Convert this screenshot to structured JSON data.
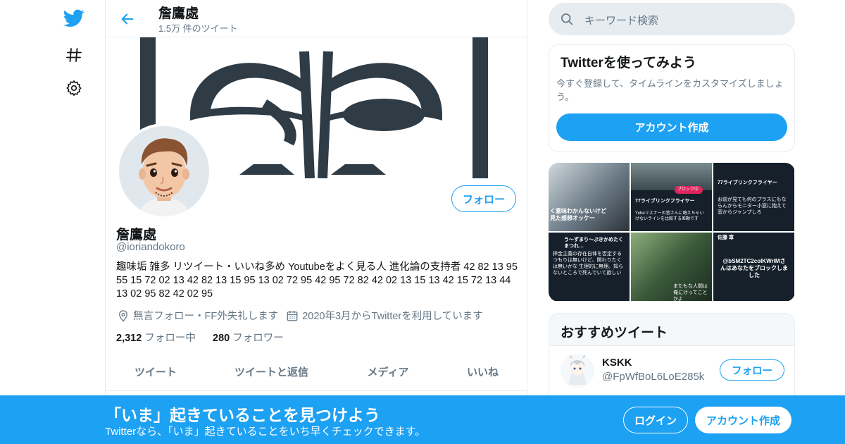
{
  "colors": {
    "accent": "#1da1f2",
    "text": "#14171a",
    "muted": "#657786",
    "border": "#e6ecf0"
  },
  "nav": {
    "icons": [
      "twitter-logo-icon",
      "hashtag-icon",
      "gear-icon"
    ]
  },
  "header": {
    "name": "詹鷹處",
    "tweet_count": "1.5万 件のツイート"
  },
  "profile": {
    "name": "詹鷹處",
    "handle": "@ioriandokoro",
    "follow_label": "フォロー",
    "bio": "趣味垢 雑多 リツイート・いいね多め Youtubeをよく見る人 進化論の支持者 42 82 13 95 55 15 72 02 13 42 82 13 15 95 13 02 72 95 42 95 72 82 42 02 13 15 13 42 15 72 13 44 13 02 95 82 42 02 95",
    "location": "無言フォロー・FF外失礼します",
    "joined": "2020年3月からTwitterを利用しています",
    "following_count": "2,312",
    "following_label": "フォロー中",
    "followers_count": "280",
    "followers_label": "フォロワー"
  },
  "tabs": [
    "ツイート",
    "ツイートと返信",
    "メディア",
    "いいね"
  ],
  "search": {
    "placeholder": "キーワード検索"
  },
  "join_card": {
    "title": "Twitterを使ってみよう",
    "description": "今すぐ登録して、タイムラインをカスタマイズしましょう。",
    "button": "アカウント作成"
  },
  "media_grid": {
    "cells": [
      {
        "caption": "く意味わかんないけど見た感想オッケー"
      },
      {
        "title": "77ライブリンクフライヤー",
        "badge": "ブロック中",
        "caption": "Yubeリスナーの皆さんに踏えちゃいけないラインを比較する差動です"
      },
      {
        "title": "77ライブリンクフライヤー",
        "caption": "お前が見ても何のプラスにもならんからモニター小窓に抱えて窓からジャンプしろ"
      },
      {
        "title": "う〜ずまり〜ぷきかめたくまつれ…",
        "caption": "拝金主義の存在自体を否定するつもりは無いけど、関わりたくは無いかな 生理的に無理。知らないところで死んでいて欲しい"
      },
      {
        "caption": "またもな人間は俺にけってことかよ"
      },
      {
        "title": "佐藤 章",
        "caption": "@bSM2TC2colKWrlMさんはあなたをブロックしました"
      }
    ]
  },
  "recommendations": {
    "title": "おすすめツイート",
    "items": [
      {
        "name": "KSKK",
        "handle": "@FpWfBoL6LoE285k",
        "button": "フォロー"
      }
    ]
  },
  "bottom_bar": {
    "title": "「いま」起きていることを見つけよう",
    "subtitle": "Twitterなら、「いま」起きていることをいち早くチェックできます。",
    "login": "ログイン",
    "signup": "アカウント作成"
  }
}
